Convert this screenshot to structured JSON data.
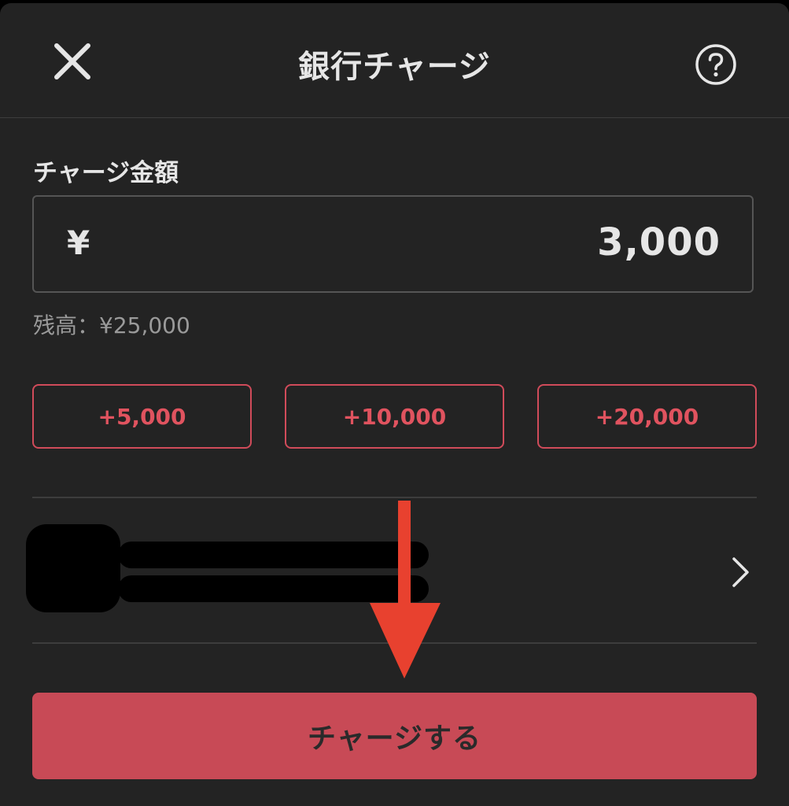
{
  "header": {
    "title": "銀行チャージ",
    "close_icon": "close-icon",
    "help_icon": "help-icon"
  },
  "charge": {
    "label": "チャージ金額",
    "currency_symbol": "¥",
    "amount": "3,000",
    "balance": "残高：¥25,000"
  },
  "quick_amounts": [
    "+5,000",
    "+10,000",
    "+20,000"
  ],
  "account": {
    "redacted": true,
    "chevron_icon": "chevron-right-icon"
  },
  "annotation": {
    "arrow_icon": "arrow-down-icon",
    "color": "#e8412f"
  },
  "submit": {
    "label": "チャージする"
  },
  "colors": {
    "background": "#232323",
    "accent": "#c84a56",
    "accent_text": "#e0535f"
  }
}
